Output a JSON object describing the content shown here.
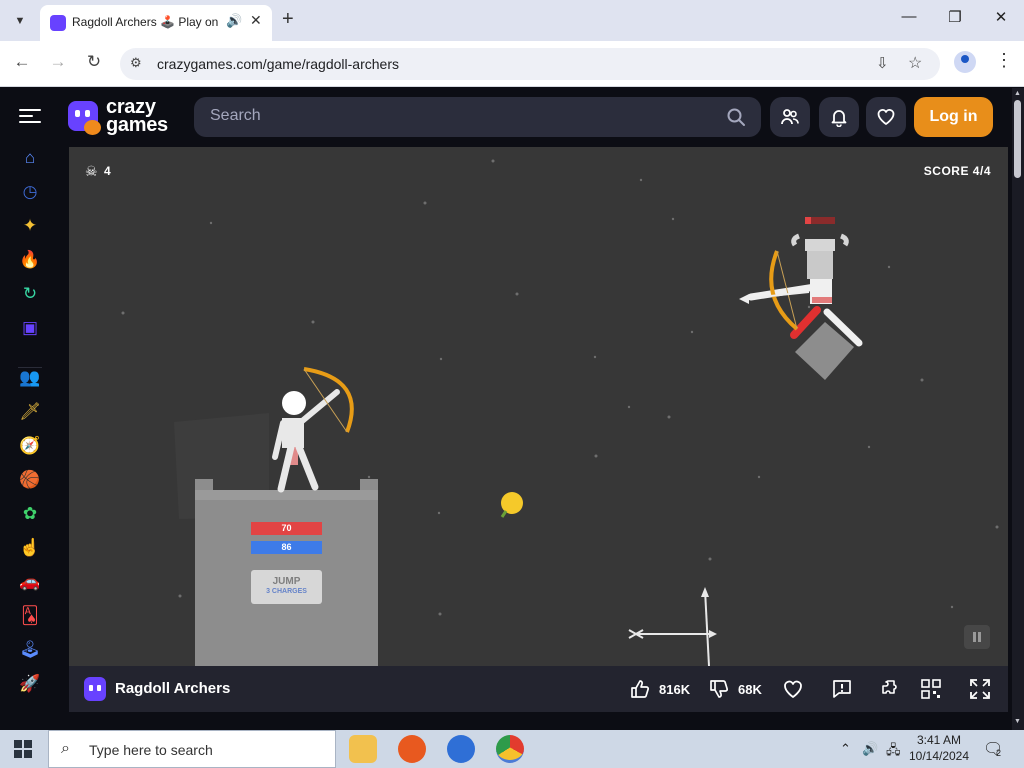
{
  "browser": {
    "tab_title": "Ragdoll Archers 🕹️ Play on CrazyGames",
    "url": "crazygames.com/game/ragdoll-archers"
  },
  "site": {
    "logo_text_top": "crazy",
    "logo_text_bottom": "games",
    "search_placeholder": "Search",
    "login_label": "Log in"
  },
  "sidebar": {
    "items": [
      {
        "icon": "home-icon",
        "glyph": "⌂",
        "color": "#5b8cff"
      },
      {
        "icon": "recent-icon",
        "glyph": "◷",
        "color": "#3f6bd6"
      },
      {
        "icon": "new-sparkle-icon",
        "glyph": "✦",
        "color": "#f4c034"
      },
      {
        "icon": "trending-fire-icon",
        "glyph": "🔥",
        "color": "#ff7a1a"
      },
      {
        "icon": "updated-icon",
        "glyph": "↻",
        "color": "#37d6a3"
      },
      {
        "icon": "originals-icon",
        "glyph": "▣",
        "color": "#6842ff"
      },
      {
        "icon": "multiplayer-icon",
        "glyph": "👥",
        "color": "#4ea2ff"
      },
      {
        "icon": "action-sword-icon",
        "glyph": "🗡",
        "color": "#f0c040"
      },
      {
        "icon": "adventure-compass-icon",
        "glyph": "🧭",
        "color": "#ff5555"
      },
      {
        "icon": "basketball-icon",
        "glyph": "🏀",
        "color": "#ff7b1c"
      },
      {
        "icon": "casual-flower-icon",
        "glyph": "✿",
        "color": "#3fd16b"
      },
      {
        "icon": "clicker-icon",
        "glyph": "☝",
        "color": "#ff6fa8"
      },
      {
        "icon": "driving-car-icon",
        "glyph": "🚗",
        "color": "#ffb01f"
      },
      {
        "icon": "cards-icon",
        "glyph": "🂡",
        "color": "#ff4d4d"
      },
      {
        "icon": "controller-joystick-icon",
        "glyph": "🕹",
        "color": "#5b8cff"
      },
      {
        "icon": "rocket-icon",
        "glyph": "🚀",
        "color": "#ff9b3a"
      }
    ]
  },
  "game": {
    "kills": "4",
    "score": "SCORE 4/4",
    "player_hp": "70",
    "player_energy": "86",
    "jump_label": "JUMP",
    "jump_charges": "3 CHARGES"
  },
  "gamebar": {
    "title": "Ragdoll Archers",
    "likes": "816K",
    "dislikes": "68K"
  },
  "taskbar": {
    "search_placeholder": "Type here to search",
    "time": "3:41 AM",
    "date": "10/14/2024",
    "notifications": "2"
  },
  "colors": {
    "brand_purple": "#6842ff",
    "login_orange": "#e88e1a",
    "game_bg": "#373737",
    "hp_red": "#e24444",
    "energy_blue": "#3e7be8"
  }
}
